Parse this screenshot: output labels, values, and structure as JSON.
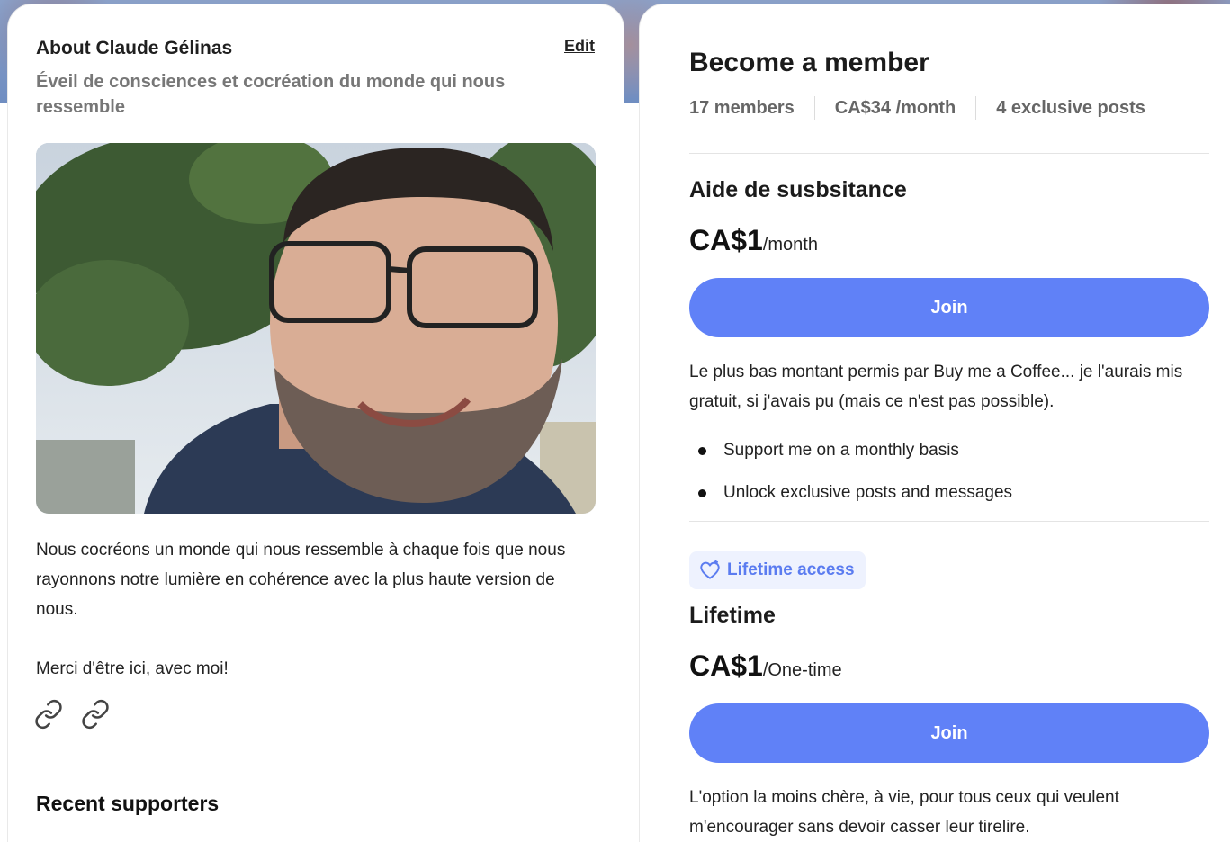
{
  "about": {
    "title": "About Claude Gélinas",
    "edit_label": "Edit",
    "tagline": "Éveil de consciences et cocréation du monde qui nous ressemble",
    "bio_paragraphs": [
      "Nous cocréons un monde qui nous ressemble à chaque fois que nous rayonnons notre lumière en cohérence avec la plus haute version de nous.",
      "Merci d'être ici, avec moi!"
    ],
    "links": [
      "link-icon",
      "link-icon"
    ],
    "recent_supporters_title": "Recent supporters"
  },
  "membership": {
    "title": "Become a member",
    "stats": {
      "members": "17 members",
      "price": "CA$34 /month",
      "posts": "4 exclusive posts"
    },
    "tiers": [
      {
        "name": "Aide de susbsitance",
        "price": "CA$1",
        "period": "/month",
        "join_label": "Join",
        "description": "Le plus bas montant permis par Buy me a Coffee... je l'aurais mis gratuit, si j'avais pu (mais ce n'est pas possible).",
        "perks": [
          "Support me on a monthly basis",
          "Unlock exclusive posts and messages"
        ]
      },
      {
        "badge": "Lifetime access",
        "name": "Lifetime",
        "price": "CA$1",
        "period": "/One-time",
        "join_label": "Join",
        "description": "L'option la moins chère, à vie, pour tous ceux qui veulent m'encourager sans devoir casser leur tirelire."
      }
    ]
  },
  "colors": {
    "accent": "#6081f7",
    "badge_bg": "#eef2fe",
    "badge_text": "#5b7cf0",
    "tagline": "#777777"
  }
}
